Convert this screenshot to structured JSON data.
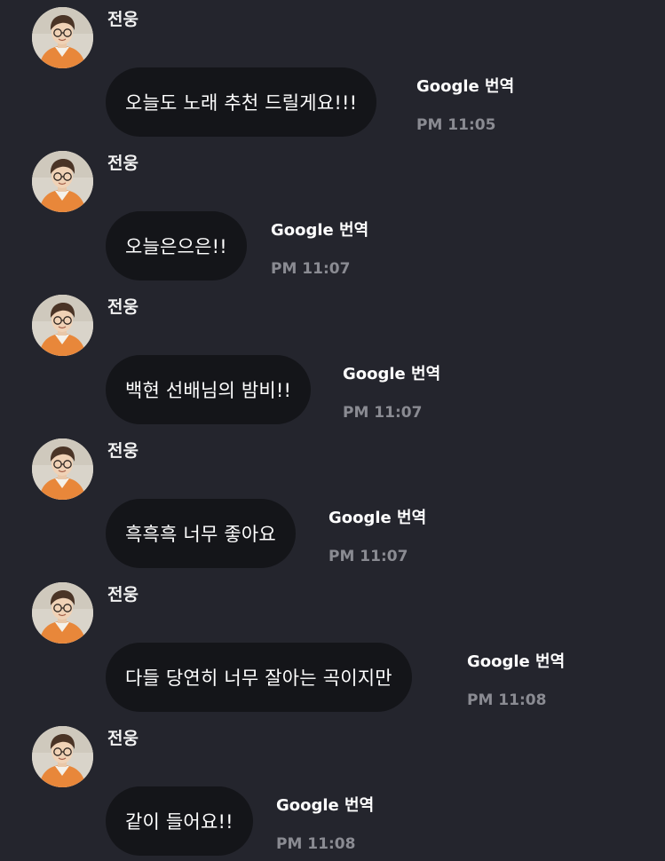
{
  "messages": [
    {
      "sender": "전웅",
      "text": "오늘도 노래 추천 드릴게요!!!",
      "translate_label": "Google 번역",
      "time": "PM 11:05"
    },
    {
      "sender": "전웅",
      "text": "오늘은으은!!",
      "translate_label": "Google 번역",
      "time": "PM 11:07"
    },
    {
      "sender": "전웅",
      "text": "백현 선배님의 밤비!!",
      "translate_label": "Google 번역",
      "time": "PM 11:07"
    },
    {
      "sender": "전웅",
      "text": "흑흑흑 너무 좋아요",
      "translate_label": "Google 번역",
      "time": "PM 11:07"
    },
    {
      "sender": "전웅",
      "text": "다들 당연히 너무 잘아는 곡이지만",
      "translate_label": "Google 번역",
      "time": "PM 11:08"
    },
    {
      "sender": "전웅",
      "text": "같이 들어요!!",
      "translate_label": "Google 번역",
      "time": "PM 11:08"
    }
  ],
  "avatar_icon": "profile-photo-avatar",
  "colors": {
    "background": "#24252d",
    "bubble": "#141519",
    "text": "#ffffff",
    "time": "#8a8b92"
  }
}
